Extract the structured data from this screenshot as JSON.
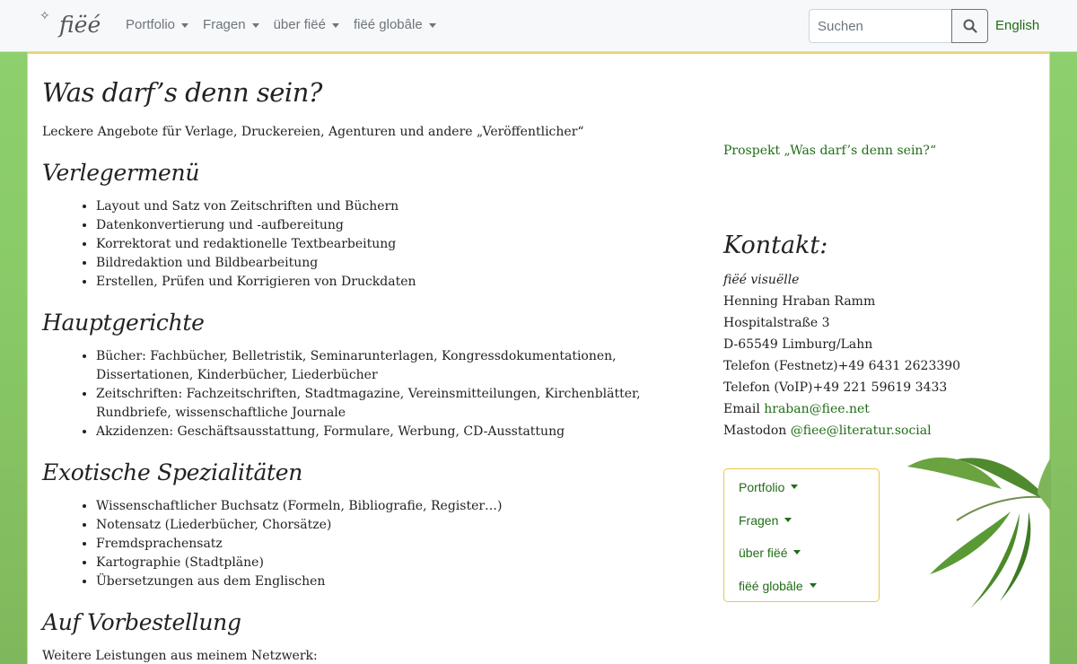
{
  "navbar": {
    "logo_text": "fiëé",
    "logo_star": "✧",
    "links": [
      {
        "label": "Portfolio"
      },
      {
        "label": "Fragen"
      },
      {
        "label": "über fiëé"
      },
      {
        "label": "fiëé globâle"
      }
    ],
    "search_placeholder": "Suchen",
    "search_icon": "search-icon",
    "language_label": "English"
  },
  "colors": {
    "accent_green": "#1f6d16",
    "panel_border": "#e8d36b",
    "background_green": "#8fd06f"
  },
  "main": {
    "title": "Was darf’s denn sein?",
    "intro": "Leckere Angebote für Verlage, Druckereien, Agenturen und andere „Veröffentlicher“",
    "sections": [
      {
        "title": "Verlegermenü",
        "items": [
          "Layout und Satz von Zeitschriften und Büchern",
          "Datenkonvertierung und -aufbereitung",
          "Korrektorat und redaktionelle Textbearbeitung",
          "Bildredaktion und Bildbearbeitung",
          "Erstellen, Prüfen und Korrigieren von Druckdaten"
        ]
      },
      {
        "title": "Hauptgerichte",
        "items": [
          "Bücher: Fachbücher, Belletristik, Seminarunterlagen, Kongressdokumentationen, Dissertationen, Kinderbücher, Liederbücher",
          "Zeitschriften: Fachzeitschriften, Stadtmagazine, Vereinsmitteilungen, Kirchenblätter, Rundbriefe, wissenschaftliche Journale",
          "Akzidenzen: Geschäftsausstattung, Formulare, Werbung, CD-Ausstattung"
        ]
      },
      {
        "title": "Exotische Spezialitäten",
        "items": [
          "Wissenschaftlicher Buchsatz (Formeln, Bibliografie, Register…)",
          "Notensatz (Liederbücher, Chorsätze)",
          "Fremdsprachensatz",
          "Kartographie (Stadtpläne)",
          "Übersetzungen aus dem Englischen"
        ]
      },
      {
        "title": "Auf Vorbestellung",
        "note": "Weitere Leistungen aus meinem Netzwerk:"
      }
    ]
  },
  "sidebar": {
    "prospekt_link": "Prospekt „Was darf’s denn sein?“",
    "contact_title": "Kontakt:",
    "company": "fiëé visuëlle",
    "name": "Henning Hraban Ramm",
    "street": "Hospitalstraße 3",
    "city": "D-65549 Limburg/Lahn",
    "phone_label": "Telefon (Festnetz)",
    "phone": "+49 6431 2623390",
    "voip_label": "Telefon (VoIP)",
    "voip": "+49 221 59619 3433",
    "email_label": "Email",
    "email": "hraban@fiee.net",
    "mastodon_label": "Mastodon",
    "mastodon": "@fiee@literatur.social",
    "nav": [
      {
        "label": "Portfolio"
      },
      {
        "label": "Fragen"
      },
      {
        "label": "über fiëé"
      },
      {
        "label": "fiëé globâle"
      }
    ]
  }
}
